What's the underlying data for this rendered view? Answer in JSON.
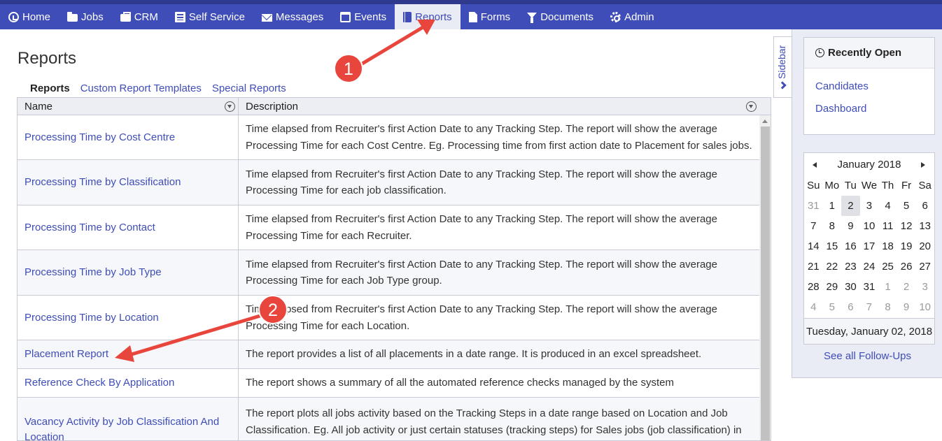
{
  "nav": {
    "items": [
      {
        "label": "Home",
        "icon": "home-icon"
      },
      {
        "label": "Jobs",
        "icon": "folder-icon"
      },
      {
        "label": "CRM",
        "icon": "briefcase-icon"
      },
      {
        "label": "Self Service",
        "icon": "list-icon"
      },
      {
        "label": "Messages",
        "icon": "envelope-icon"
      },
      {
        "label": "Events",
        "icon": "calendar-icon"
      },
      {
        "label": "Reports",
        "icon": "book-icon",
        "active": true
      },
      {
        "label": "Forms",
        "icon": "file-icon"
      },
      {
        "label": "Documents",
        "icon": "filter-icon"
      },
      {
        "label": "Admin",
        "icon": "gear-icon"
      }
    ]
  },
  "page": {
    "title": "Reports",
    "subtabs": [
      "Reports",
      "Custom Report Templates",
      "Special Reports"
    ],
    "active_subtab": "Reports"
  },
  "grid": {
    "columns": [
      "Name",
      "Description"
    ],
    "rows": [
      {
        "name": "Processing Time by Cost Centre",
        "description": "Time elapsed from Recruiter's first Action Date to any Tracking Step. The report will show the average Processing Time for each Cost Centre. Eg. Processing time from first action date to Placement for sales jobs."
      },
      {
        "name": "Processing Time by Classification",
        "description": "Time elapsed from Recruiter's first Action Date to any Tracking Step. The report will show the average Processing Time for each job classification."
      },
      {
        "name": "Processing Time by Contact",
        "description": "Time elapsed from Recruiter's first Action Date to any Tracking Step. The report will show the average Processing Time for each Recruiter."
      },
      {
        "name": "Processing Time by Job Type",
        "description": "Time elapsed from Recruiter's first Action Date to any Tracking Step. The report will show the average Processing Time for each Job Type group."
      },
      {
        "name": "Processing Time by Location",
        "description": "Time elapsed from Recruiter's first Action Date to any Tracking Step. The report will show the average Processing Time for each Location."
      },
      {
        "name": "Placement Report",
        "description": "The report provides a list of all placements in a date range. It is produced in an excel spreadsheet."
      },
      {
        "name": "Reference Check By Application",
        "description": "The report shows a summary of all the automated reference checks managed by the system"
      },
      {
        "name": "Vacancy Activity by Job Classification And Location",
        "description": "The report plots all jobs activity based on the Tracking Steps in a date range based on Location and Job Classification. Eg. All job activity or just certain statuses (tracking steps) for Sales jobs (job classification) in"
      }
    ]
  },
  "sidebar": {
    "toggle_label": "Sidebar",
    "recent": {
      "title": "Recently Open",
      "links": [
        "Candidates",
        "Dashboard"
      ]
    },
    "calendar": {
      "month": "January 2018",
      "weekdays": [
        "Su",
        "Mo",
        "Tu",
        "We",
        "Th",
        "Fr",
        "Sa"
      ],
      "weeks": [
        [
          "31",
          "1",
          "2",
          "3",
          "4",
          "5",
          "6"
        ],
        [
          "7",
          "8",
          "9",
          "10",
          "11",
          "12",
          "13"
        ],
        [
          "14",
          "15",
          "16",
          "17",
          "18",
          "19",
          "20"
        ],
        [
          "21",
          "22",
          "23",
          "24",
          "25",
          "26",
          "27"
        ],
        [
          "28",
          "29",
          "30",
          "31",
          "1",
          "2",
          "3"
        ],
        [
          "4",
          "5",
          "6",
          "7",
          "8",
          "9",
          "10"
        ]
      ],
      "selected_day": "2",
      "selected_date": "Tuesday, January 02, 2018"
    },
    "followups_link": "See all Follow-Ups"
  },
  "annotations": {
    "callouts": [
      "1",
      "2"
    ],
    "color": "#e8453c"
  },
  "colors": {
    "nav_bg": "#3f4db8",
    "link": "#3f4db8"
  }
}
